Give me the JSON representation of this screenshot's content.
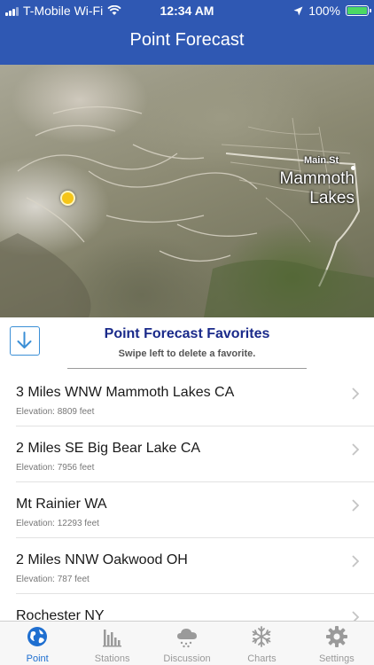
{
  "status_bar": {
    "carrier": "T-Mobile Wi-Fi",
    "time": "12:34 AM",
    "battery": "100%"
  },
  "nav": {
    "title": "Point Forecast"
  },
  "map": {
    "street_label": "Main St",
    "town_label_line1": "Mammoth",
    "town_label_line2": "Lakes"
  },
  "favorites": {
    "title": "Point Forecast Favorites",
    "hint": "Swipe left to delete a favorite.",
    "items": [
      {
        "name": "3 Miles WNW Mammoth Lakes CA",
        "elevation": "Elevation: 8809 feet"
      },
      {
        "name": "2 Miles SE Big Bear Lake CA",
        "elevation": "Elevation: 7956 feet"
      },
      {
        "name": "Mt Rainier WA",
        "elevation": "Elevation: 12293 feet"
      },
      {
        "name": "2 Miles NNW Oakwood OH",
        "elevation": "Elevation: 787 feet"
      },
      {
        "name": "Rochester NY",
        "elevation": ""
      }
    ]
  },
  "tabs": [
    {
      "label": "Point",
      "icon": "globe-icon",
      "active": true
    },
    {
      "label": "Stations",
      "icon": "bar-chart-icon",
      "active": false
    },
    {
      "label": "Discussion",
      "icon": "cloud-snow-icon",
      "active": false
    },
    {
      "label": "Charts",
      "icon": "snowflake-icon",
      "active": false
    },
    {
      "label": "Settings",
      "icon": "gear-icon",
      "active": false
    }
  ],
  "colors": {
    "header_bg": "#2f58b3",
    "accent": "#1f6fd0",
    "favorites_title": "#1a2a8a",
    "location_marker": "#f5c518"
  }
}
